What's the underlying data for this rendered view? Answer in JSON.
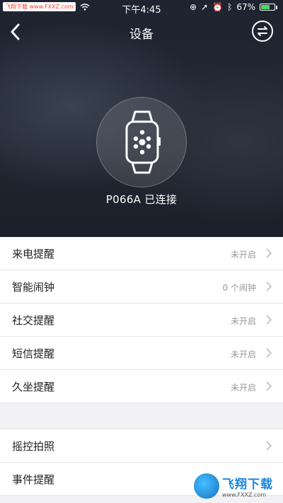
{
  "status_bar": {
    "carrier": "飞翔下载 www.FXXZ.com",
    "time": "下午4:45",
    "battery": "67%",
    "battery_level": 0.67
  },
  "nav": {
    "title": "设备",
    "back_icon": "chevron-left-icon",
    "switch_icon": "swap-arrows-icon"
  },
  "device": {
    "status_text": "P066A 已连接",
    "icon": "smartwatch-icon"
  },
  "settings_group_1": [
    {
      "label": "来电提醒",
      "value": "未开启"
    },
    {
      "label": "智能闹钟",
      "value": "0 个闹钟"
    },
    {
      "label": "社交提醒",
      "value": "未开启"
    },
    {
      "label": "短信提醒",
      "value": "未开启"
    },
    {
      "label": "久坐提醒",
      "value": "未开启"
    }
  ],
  "settings_group_2": [
    {
      "label": "摇控拍照",
      "value": ""
    },
    {
      "label": "事件提醒",
      "value": ""
    }
  ],
  "watermark": {
    "title": "飞翔下载",
    "url": "www.FXXZ.com"
  },
  "colors": {
    "hero_bg": "#1e2330",
    "accent_green": "#4cd964",
    "list_bg": "#ffffff",
    "page_bg": "#f2f2f4"
  }
}
